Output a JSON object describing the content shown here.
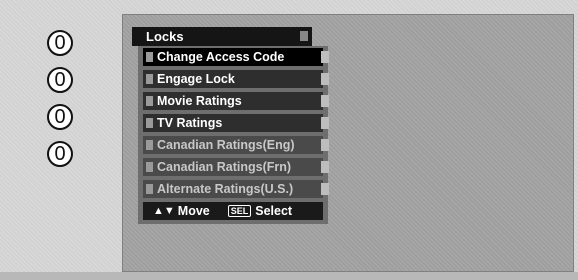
{
  "channel_digits": [
    "0",
    "0",
    "0",
    "0"
  ],
  "menu": {
    "title": "Locks",
    "items": [
      {
        "label": "Change Access Code",
        "state": "selected"
      },
      {
        "label": "Engage Lock",
        "state": "normal"
      },
      {
        "label": "Movie Ratings",
        "state": "normal"
      },
      {
        "label": "TV Ratings",
        "state": "normal"
      },
      {
        "label": "Canadian Ratings(Eng)",
        "state": "faded"
      },
      {
        "label": "Canadian Ratings(Frn)",
        "state": "faded"
      },
      {
        "label": "Alternate Ratings(U.S.)",
        "state": "faded"
      }
    ]
  },
  "footer": {
    "move_label": "Move",
    "sel_key": "SEL",
    "select_label": "Select"
  },
  "colors": {
    "screen": "#d2d2d2",
    "panel": "#9e9e9e",
    "menu_item": "#2e2e2e",
    "menu_selected": "#000000"
  }
}
